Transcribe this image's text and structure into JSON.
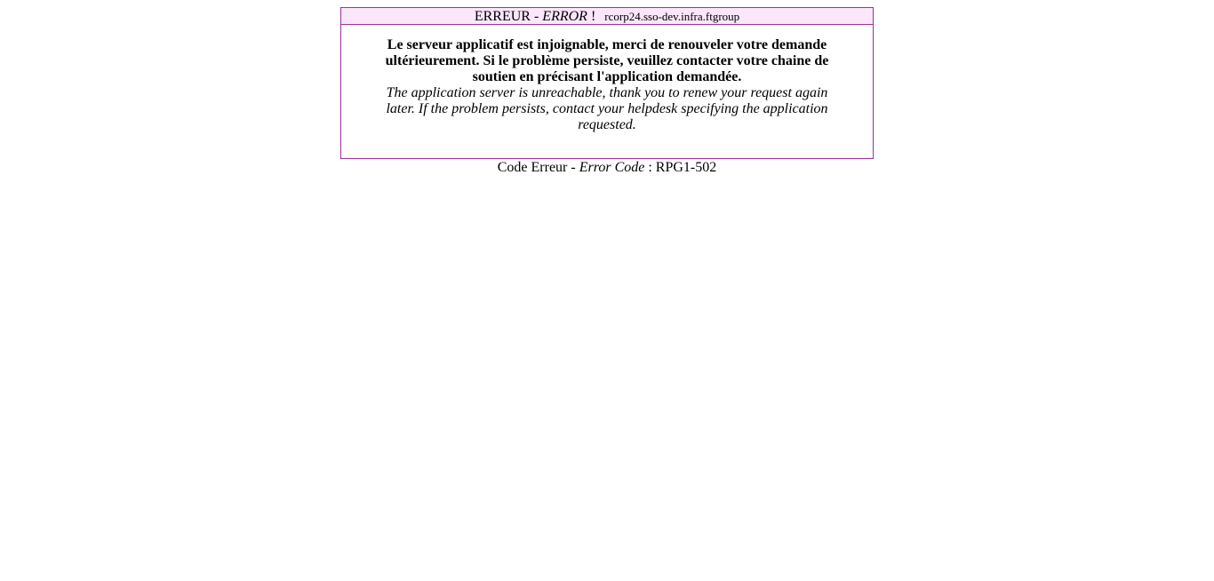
{
  "header": {
    "title_fr": "ERREUR",
    "separator": " - ",
    "title_en": "ERROR",
    "exclamation": " !",
    "host": "rcorp24.sso-dev.infra.ftgroup"
  },
  "message": {
    "fr": "Le serveur applicatif est injoignable, merci de renouveler votre demande ultérieurement. Si le problème persiste, veuillez contacter votre chaine de soutien en précisant l'application demandée.",
    "en": "The application server is unreachable, thank you to renew your request again later. If the problem persists, contact your helpdesk specifying the application requested."
  },
  "footer": {
    "code_label_fr": "Code Erreur",
    "separator": " - ",
    "code_label_en": "Error Code",
    "colon": " : ",
    "code_value": "RPG1-502"
  },
  "colors": {
    "border": "#993399",
    "header_bg": "#fbe6fb"
  }
}
